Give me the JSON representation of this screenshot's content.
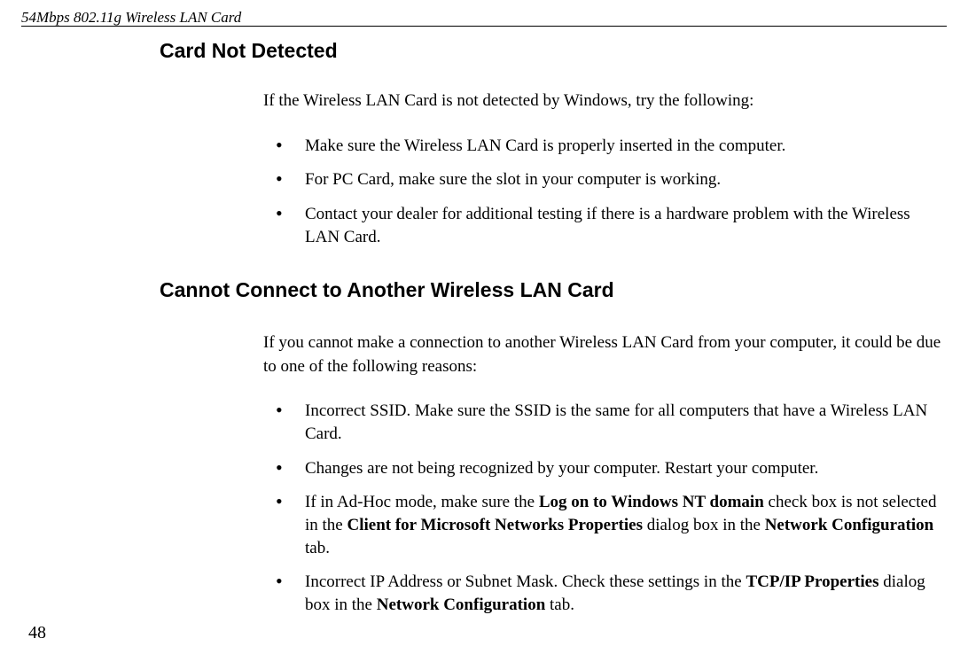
{
  "header": {
    "docTitle": "54Mbps 802.11g Wireless LAN Card"
  },
  "pageNumber": "48",
  "sections": {
    "s1": {
      "heading": "Card Not Detected",
      "intro": "If the Wireless LAN Card is not detected by Windows, try the following:",
      "items": {
        "i0": "Make sure the Wireless LAN Card is properly inserted in the computer.",
        "i1": "For PC Card, make sure the slot in your computer is working.",
        "i2": "Contact your dealer for additional testing if there is a hardware problem with the Wireless LAN Card."
      }
    },
    "s2": {
      "heading": "Cannot Connect to Another Wireless LAN Card",
      "intro": "If you cannot make a connection to another Wireless LAN Card from your computer, it could be due to one of the following reasons:",
      "items": {
        "i0": "Incorrect SSID. Make sure the SSID is the same for all computers that have a Wireless LAN Card.",
        "i1": "Changes are not being recognized by your computer. Restart your computer.",
        "i2": {
          "pre": "If in Ad-Hoc mode, make sure the ",
          "b1": "Log on to Windows NT domain",
          "mid1": " check box is not selected in the ",
          "b2": "Client for Microsoft Networks Properties",
          "mid2": " dialog box in the ",
          "b3": "Network Configuration",
          "post": " tab."
        },
        "i3": {
          "pre": "Incorrect IP Address or Subnet Mask. Check these settings in the ",
          "b1": "TCP/IP Properties",
          "mid1": " dialog box in the ",
          "b2": "Network Configuration",
          "post": " tab."
        }
      }
    }
  }
}
